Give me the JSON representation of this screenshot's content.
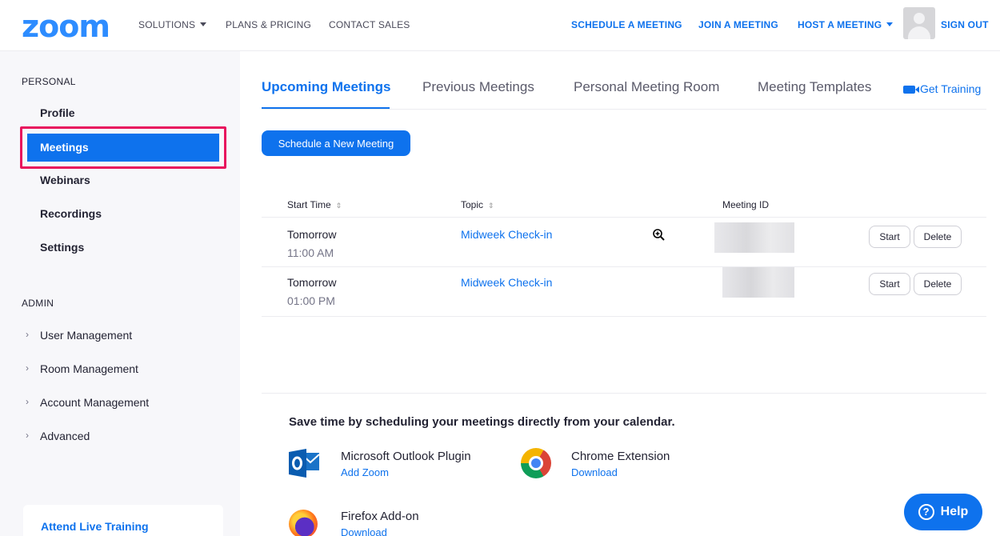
{
  "topnav": {
    "logo": "zoom",
    "solutions": "SOLUTIONS",
    "plans": "PLANS & PRICING",
    "contact": "CONTACT SALES",
    "schedule": "SCHEDULE A MEETING",
    "join": "JOIN A MEETING",
    "host": "HOST A MEETING",
    "signout": "SIGN OUT"
  },
  "sidebar": {
    "personal_label": "PERSONAL",
    "personal_items": [
      "Profile",
      "Meetings",
      "Webinars",
      "Recordings",
      "Settings"
    ],
    "admin_label": "ADMIN",
    "admin_items": [
      "User Management",
      "Room Management",
      "Account Management",
      "Advanced"
    ],
    "training": "Attend Live Training",
    "selected": "Meetings"
  },
  "tabs": [
    "Upcoming Meetings",
    "Previous Meetings",
    "Personal Meeting Room",
    "Meeting Templates"
  ],
  "get_training": "Get Training",
  "schedule_button": "Schedule a New Meeting",
  "table": {
    "headers": [
      "Start Time",
      "Topic",
      "Meeting ID"
    ],
    "rows": [
      {
        "day": "Tomorrow",
        "time": "11:00 AM",
        "topic": "Midweek Check-in",
        "start": "Start",
        "delete": "Delete"
      },
      {
        "day": "Tomorrow",
        "time": "01:00 PM",
        "topic": "Midweek Check-in",
        "start": "Start",
        "delete": "Delete"
      }
    ]
  },
  "calendar": {
    "title": "Save time by scheduling your meetings directly from your calendar.",
    "plugins": [
      {
        "name": "Microsoft Outlook Plugin",
        "link": "Add Zoom",
        "icon": "outlook-icon"
      },
      {
        "name": "Chrome Extension",
        "link": "Download",
        "icon": "chrome-icon"
      },
      {
        "name": "Firefox Add-on",
        "link": "Download",
        "icon": "firefox-icon"
      }
    ]
  },
  "help": "Help",
  "colors": {
    "brand": "#2d8cff",
    "accent": "#0e72ed",
    "highlight": "#e8125d"
  }
}
